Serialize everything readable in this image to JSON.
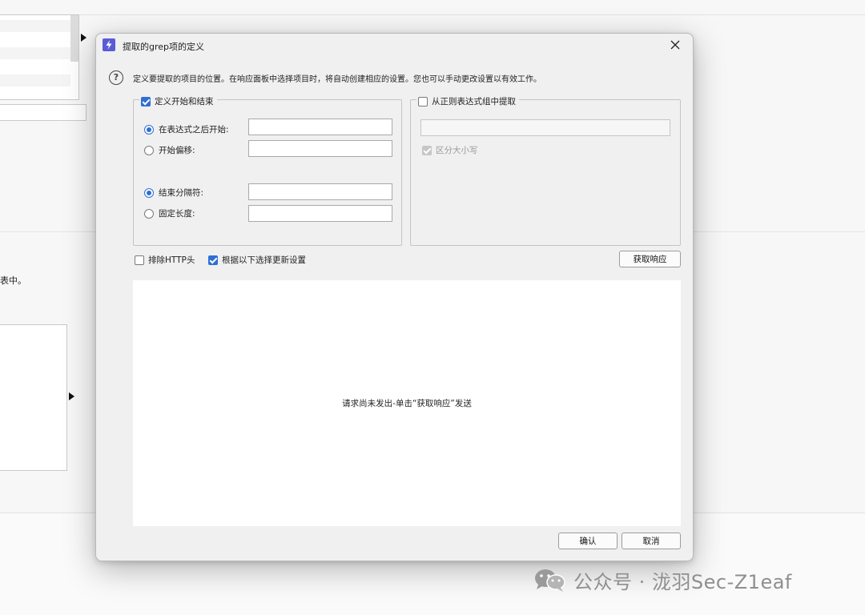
{
  "dialog": {
    "title": "提取的grep项的定义",
    "description": "定义要提取的项目的位置。在响应面板中选择项目时，将自动创建相应的设置。您也可以手动更改设置以有效工作。",
    "define_group": {
      "checkbox_label": "定义开始和结束",
      "checked": true,
      "start_after_label": "在表达式之后开始:",
      "start_after_value": "",
      "start_offset_label": "开始偏移:",
      "start_offset_value": "",
      "end_delimiter_label": "结束分隔符:",
      "end_delimiter_value": "",
      "fixed_length_label": "固定长度:",
      "fixed_length_value": "",
      "start_mode_selected": "在表达式之后开始",
      "end_mode_selected": "结束分隔符"
    },
    "regex_group": {
      "checkbox_label": "从正则表达式组中提取",
      "checked": false,
      "regex_value": "",
      "case_sensitive_label": "区分大小写",
      "case_sensitive_checked": true
    },
    "exclude_http_label": "排除HTTP头",
    "exclude_http_checked": false,
    "update_config_label": "根据以下选择更新设置",
    "update_config_checked": true,
    "fetch_response_button": "获取响应",
    "response_placeholder": "请求尚未发出-单击“获取响应”发送",
    "ok_button": "确认",
    "cancel_button": "取消"
  },
  "background": {
    "partial_text": "表中。"
  },
  "watermark": {
    "text": "公众号 · 泷羽Sec-Z1eaf"
  },
  "colors": {
    "accent": "#2f6fd4",
    "app_icon": "#5a5bd6",
    "dialog_bg": "#f0f0f0"
  }
}
